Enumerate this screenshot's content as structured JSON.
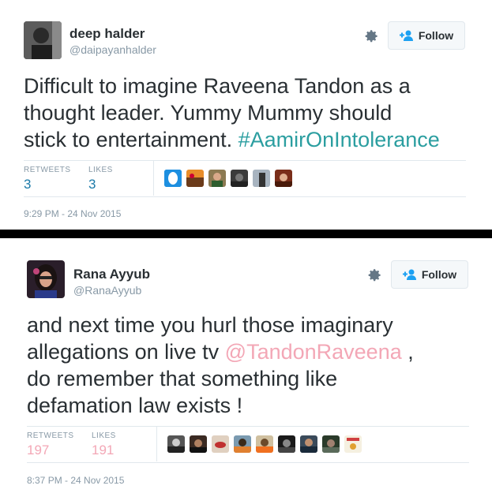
{
  "tweets": [
    {
      "name": "deep halder",
      "handle": "@daipayanhalder",
      "follow_label": "Follow",
      "text_parts": [
        "Difficult to imagine Raveena Tandon as a",
        "thought leader. Yummy Mummy should",
        "stick to entertainment. ",
        "#AamirOnIntolerance"
      ],
      "retweets_label": "RETWEETS",
      "retweets": "3",
      "likes_label": "LIKES",
      "likes": "3",
      "timestamp": "9:29 PM - 24 Nov 2015",
      "stat_color": "#1b7aa8"
    },
    {
      "name": "Rana Ayyub",
      "handle": "@RanaAyyub",
      "follow_label": "Follow",
      "text_parts": [
        "and next time you hurl those imaginary",
        "allegations on live tv ",
        "@TandonRaveena",
        " ,",
        "do remember that something like",
        "defamation law exists !"
      ],
      "retweets_label": "RETWEETS",
      "retweets": "197",
      "likes_label": "LIKES",
      "likes": "191",
      "timestamp": "8:37 PM - 24 Nov 2015",
      "stat_color": "#f3a7b6"
    }
  ],
  "colors": {
    "hashtag": "#2b9ea0",
    "mention": "#f3a7b6",
    "follow_icon": "#1da1f2"
  }
}
